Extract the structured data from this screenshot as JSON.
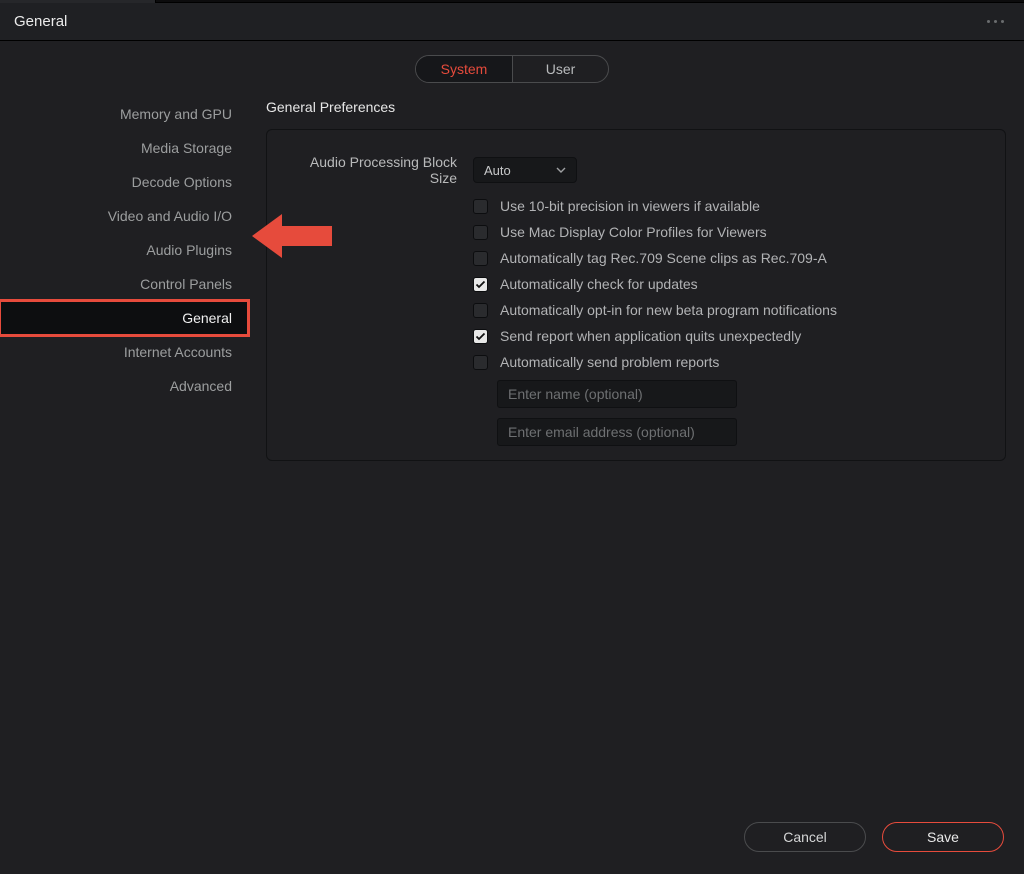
{
  "header": {
    "title": "General"
  },
  "tabs": {
    "system": "System",
    "user": "User",
    "active": "system"
  },
  "sidebar": {
    "items": [
      "Memory and GPU",
      "Media Storage",
      "Decode Options",
      "Video and Audio I/O",
      "Audio Plugins",
      "Control Panels",
      "General",
      "Internet Accounts",
      "Advanced"
    ],
    "activeIndex": 6
  },
  "panel": {
    "title": "General Preferences",
    "blockSizeLabel": "Audio Processing Block Size",
    "blockSizeValue": "Auto",
    "checks": [
      {
        "label": "Use 10-bit precision in viewers if available",
        "checked": false
      },
      {
        "label": "Use Mac Display Color Profiles for Viewers",
        "checked": false
      },
      {
        "label": "Automatically tag Rec.709 Scene clips as Rec.709-A",
        "checked": false
      },
      {
        "label": "Automatically check for updates",
        "checked": true
      },
      {
        "label": "Automatically opt-in for new beta program notifications",
        "checked": false
      },
      {
        "label": "Send report when application quits unexpectedly",
        "checked": true
      },
      {
        "label": "Automatically send problem reports",
        "checked": false
      }
    ],
    "namePlaceholder": "Enter name (optional)",
    "emailPlaceholder": "Enter email address (optional)"
  },
  "footer": {
    "cancel": "Cancel",
    "save": "Save"
  }
}
